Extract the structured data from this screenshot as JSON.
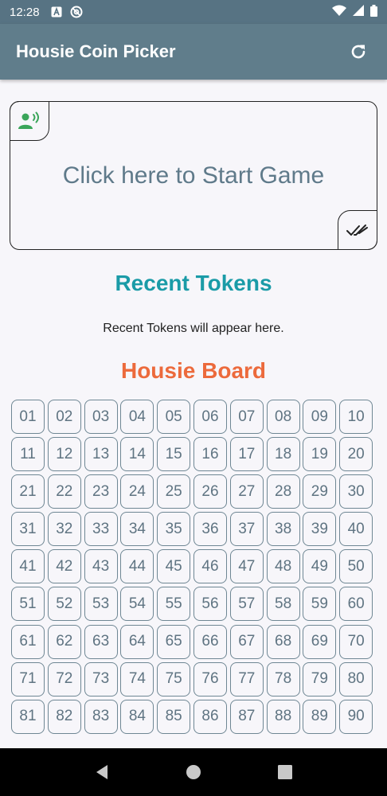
{
  "status_bar": {
    "time": "12:28",
    "icons": [
      "a-notification-icon",
      "at-sign-icon"
    ],
    "right_icons": [
      "wifi-icon",
      "signal-icon",
      "battery-icon"
    ]
  },
  "app_bar": {
    "title": "Housie Coin Picker",
    "refresh_icon": "refresh-icon",
    "color": "#607d8b"
  },
  "start_card": {
    "label": "Click here to Start Game",
    "voice_icon": "voice-icon",
    "check_icon": "double-check-icon",
    "voice_icon_color": "#3aa55a"
  },
  "recent": {
    "title": "Recent Tokens",
    "empty_text": "Recent Tokens will appear here.",
    "color": "#1a9ba7"
  },
  "board": {
    "title": "Housie Board",
    "color": "#ec6a3c",
    "numbers": [
      "01",
      "02",
      "03",
      "04",
      "05",
      "06",
      "07",
      "08",
      "09",
      "10",
      "11",
      "12",
      "13",
      "14",
      "15",
      "16",
      "17",
      "18",
      "19",
      "20",
      "21",
      "22",
      "23",
      "24",
      "25",
      "26",
      "27",
      "28",
      "29",
      "30",
      "31",
      "32",
      "33",
      "34",
      "35",
      "36",
      "37",
      "38",
      "39",
      "40",
      "41",
      "42",
      "43",
      "44",
      "45",
      "46",
      "47",
      "48",
      "49",
      "50",
      "51",
      "52",
      "53",
      "54",
      "55",
      "56",
      "57",
      "58",
      "59",
      "60",
      "61",
      "62",
      "63",
      "64",
      "65",
      "66",
      "67",
      "68",
      "69",
      "70",
      "71",
      "72",
      "73",
      "74",
      "75",
      "76",
      "77",
      "78",
      "79",
      "80",
      "81",
      "82",
      "83",
      "84",
      "85",
      "86",
      "87",
      "88",
      "89",
      "90"
    ]
  },
  "nav_bar": {
    "buttons": [
      "back-icon",
      "home-icon",
      "recents-icon"
    ]
  }
}
